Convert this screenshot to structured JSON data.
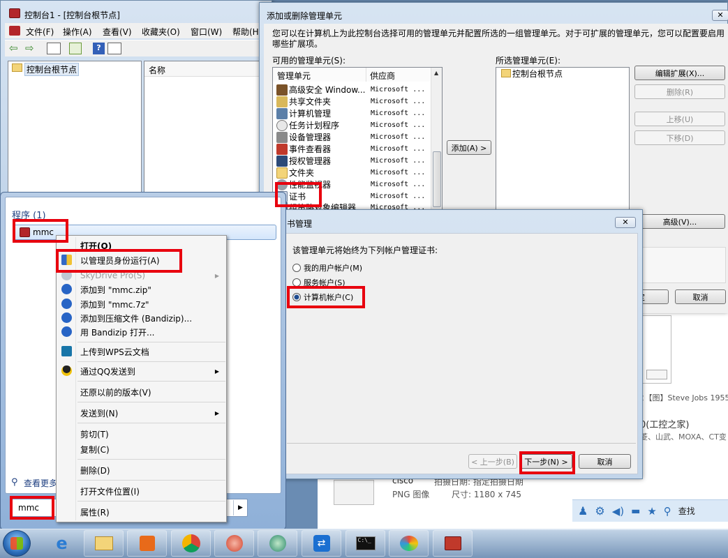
{
  "mmc_window": {
    "title": "控制台1 - [控制台根节点]",
    "menu": [
      "文件(F)",
      "操作(A)",
      "查看(V)",
      "收藏夹(O)",
      "窗口(W)",
      "帮助(H)"
    ],
    "tree_root": "控制台根节点",
    "list_header": "名称"
  },
  "snapin_dialog": {
    "title": "添加或删除管理单元",
    "description": "您可以在计算机上为此控制台选择可用的管理单元并配置所选的一组管理单元。对于可扩展的管理单元，您可以配置要启用哪些扩展项。",
    "available_label": "可用的管理单元(S):",
    "selected_label": "所选管理单元(E):",
    "columns": [
      "管理单元",
      "供应商"
    ],
    "available": [
      {
        "name": "高级安全 Window...",
        "vendor": "Microsoft ..."
      },
      {
        "name": "共享文件夹",
        "vendor": "Microsoft ..."
      },
      {
        "name": "计算机管理",
        "vendor": "Microsoft ..."
      },
      {
        "name": "任务计划程序",
        "vendor": "Microsoft ..."
      },
      {
        "name": "设备管理器",
        "vendor": "Microsoft ..."
      },
      {
        "name": "事件查看器",
        "vendor": "Microsoft ..."
      },
      {
        "name": "授权管理器",
        "vendor": "Microsoft ..."
      },
      {
        "name": "文件夹",
        "vendor": "Microsoft ..."
      },
      {
        "name": "性能监视器",
        "vendor": "Microsoft ..."
      },
      {
        "name": "证书",
        "vendor": "Microsoft ..."
      },
      {
        "name": "组策略对象编辑器",
        "vendor": "Microsoft ..."
      }
    ],
    "selected": [
      "控制台根节点"
    ],
    "add_button": "添加(A) >",
    "edit_ext_button": "编辑扩展(X)...",
    "remove_button": "删除(R)",
    "move_up_button": "上移(U)",
    "move_down_button": "下移(D)",
    "advanced_button": "高级(V)...",
    "ok_button": "定",
    "cancel_button": "取消"
  },
  "cert_dialog": {
    "title": "书管理",
    "prompt": "该管理单元将始终为下列帐户管理证书:",
    "options": [
      "我的用户帐户(M)",
      "服务帐户(S)",
      "计算机帐户(C)"
    ],
    "selected_option": "计算机帐户(C)",
    "back_button": "< 上一步(B)",
    "next_button": "下一步(N) >",
    "cancel_button": "取消"
  },
  "start_menu": {
    "programs_header": "程序 (1)",
    "program_item": "mmc",
    "see_more": "查看更多",
    "search_value": "mmc"
  },
  "context_menu": {
    "items": [
      {
        "label": "打开(O)",
        "bold": true
      },
      {
        "label": "以管理员身份运行(A)"
      },
      {
        "label": "SkyDrive Pro(S)",
        "disabled": true,
        "submenu": true
      },
      {
        "label": "添加到 \"mmc.zip\""
      },
      {
        "label": "添加到 \"mmc.7z\""
      },
      {
        "label": "添加到压缩文件 (Bandizip)..."
      },
      {
        "label": "用 Bandizip 打开..."
      },
      {
        "label": "上传到WPS云文档"
      },
      {
        "label": "通过QQ发送到",
        "submenu": true
      },
      {
        "label": "还原以前的版本(V)"
      },
      {
        "label": "发送到(N)",
        "submenu": true
      },
      {
        "label": "剪切(T)"
      },
      {
        "label": "复制(C)"
      },
      {
        "label": "删除(D)"
      },
      {
        "label": "打开文件位置(I)"
      },
      {
        "label": "属性(R)"
      }
    ]
  },
  "background": {
    "web_caption": "：【图】Steve Jobs 1955",
    "gongkong": "0(工控之家)",
    "brands": "菱、山武、MOXA、CT变",
    "file_name": "cisco",
    "file_type": "PNG 图像",
    "file_size_label": "尺寸: 1180 x 745",
    "file_date_label": "拍摄日期: 指定拍摄日期",
    "qq_find": "查找"
  },
  "colors": {
    "highlight_red": "#e8000e",
    "dialog_face": "#f0f0f0",
    "glass_title": "#c8d9ec",
    "desktop": "#6a8cb3",
    "link_blue": "#1e5aa8"
  }
}
